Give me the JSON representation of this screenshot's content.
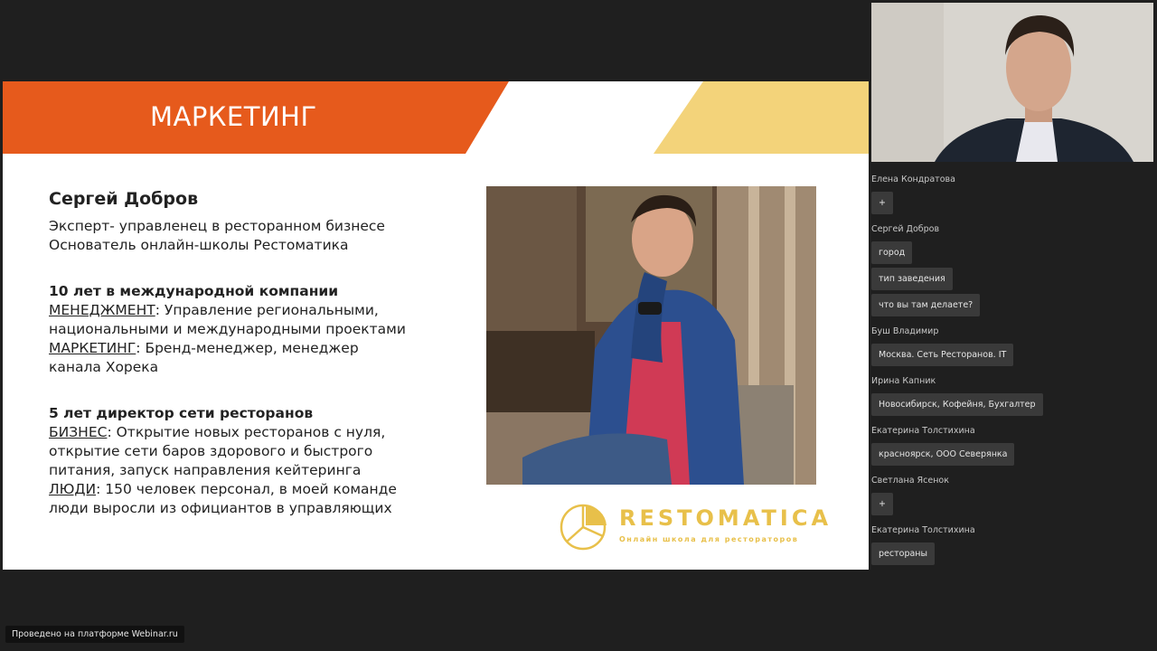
{
  "slide": {
    "title": "МАРКЕТИНГ",
    "name": "Сергей Добров",
    "subtitle_1": "Эксперт- управленец в ресторанном бизнесе",
    "subtitle_2": "Основатель онлайн-школы Рестоматика",
    "section1_heading": "10 лет в международной компании",
    "section1_l1_key": "МЕНЕДЖМЕНТ",
    "section1_l1_rest": ": Управление региональными,",
    "section1_l2": "национальными и международными проектами",
    "section1_l3_key": "МАРКЕТИНГ",
    "section1_l3_rest": ": Бренд-менеджер, менеджер",
    "section1_l4": "канала Хорека",
    "section2_heading": "5 лет директор сети ресторанов",
    "section2_l1_key": "БИЗНЕС",
    "section2_l1_rest": ": Открытие новых ресторанов с нуля,",
    "section2_l2": "открытие сети баров здорового и быстрого",
    "section2_l3": "питания, запуск направления кейтеринга",
    "section2_l4_key": "ЛЮДИ",
    "section2_l4_rest": ": 150 человек персонал, в моей команде",
    "section2_l5": "люди выросли из официантов в управляющих",
    "logo_word": "RESTOMATICA",
    "logo_tagline": "Онлайн школа для рестораторов",
    "colors": {
      "banner_orange": "#e65a1c",
      "banner_yellow": "#f3d37a",
      "logo_gold": "#e8c04a"
    }
  },
  "chat": {
    "messages": [
      {
        "author": "Елена Кондратова",
        "texts": [
          "+"
        ]
      },
      {
        "author": "Сергей Добров",
        "texts": [
          "город",
          "тип заведения",
          "что вы там делаете?"
        ]
      },
      {
        "author": "Буш Владимир",
        "texts": [
          "Москва. Сеть Ресторанов. IT"
        ]
      },
      {
        "author": "Ирина Капник",
        "texts": [
          "Новосибирск, Кофейня, Бухгалтер"
        ]
      },
      {
        "author": "Екатерина Толстихина",
        "texts": [
          "красноярск, ООО Северянка"
        ]
      },
      {
        "author": "Светлана Ясенок",
        "texts": [
          "+"
        ]
      },
      {
        "author": "Екатерина Толстихина",
        "texts": [
          "рестораны"
        ]
      }
    ]
  },
  "footer": {
    "platform_text": "Проведено на платформе Webinar.ru"
  }
}
